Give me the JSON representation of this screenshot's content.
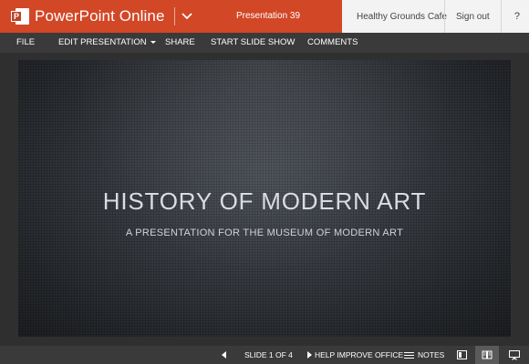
{
  "app": {
    "name": "PowerPoint Online",
    "logo_letter": "P",
    "document_title": "Presentation 39",
    "owner": "Healthy Grounds Cafe",
    "signout_label": "Sign out",
    "help_label": "?"
  },
  "menu": {
    "items": [
      "FILE",
      "EDIT PRESENTATION",
      "SHARE",
      "START SLIDE SHOW",
      "COMMENTS"
    ]
  },
  "slide": {
    "title": "HISTORY OF MODERN ART",
    "subtitle": "A PRESENTATION FOR THE MUSEUM OF MODERN ART"
  },
  "status": {
    "slide_counter": "SLIDE 1 OF 4",
    "help_improve": "HELP IMPROVE OFFICE",
    "notes_label": "NOTES"
  },
  "colors": {
    "brand": "#d24726",
    "menubar": "#3a3a3a",
    "slide_text": "#d9dde2"
  },
  "icons": [
    "powerpoint-logo-icon",
    "chevron-down-icon",
    "prev-slide-icon",
    "next-slide-icon",
    "notes-icon",
    "normal-view-icon",
    "reading-view-icon",
    "slide-show-view-icon"
  ]
}
